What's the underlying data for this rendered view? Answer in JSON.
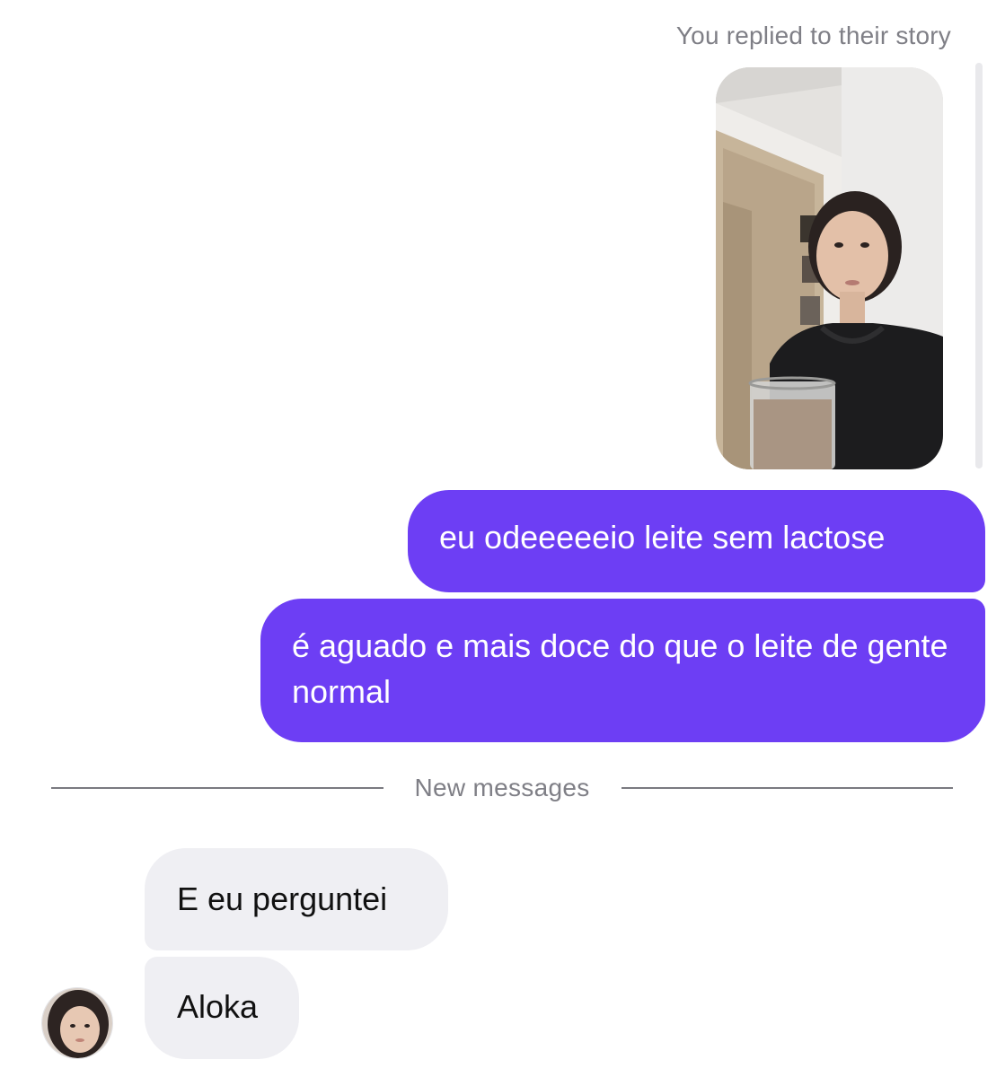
{
  "story_reply": {
    "caption": "You replied to their story"
  },
  "messages": [
    {
      "direction": "outgoing",
      "text": "eu odeeeeeio leite sem lactose"
    },
    {
      "direction": "outgoing",
      "text": "é aguado e mais doce do que o leite de gente normal"
    },
    {
      "direction": "incoming",
      "text": "E eu perguntei"
    },
    {
      "direction": "incoming",
      "text": "Aloka"
    }
  ],
  "divider": {
    "label": "New messages"
  },
  "colors": {
    "outgoing_bubble": "#6d3ef4",
    "incoming_bubble": "#efeff3",
    "meta_text": "#7f7f86"
  }
}
